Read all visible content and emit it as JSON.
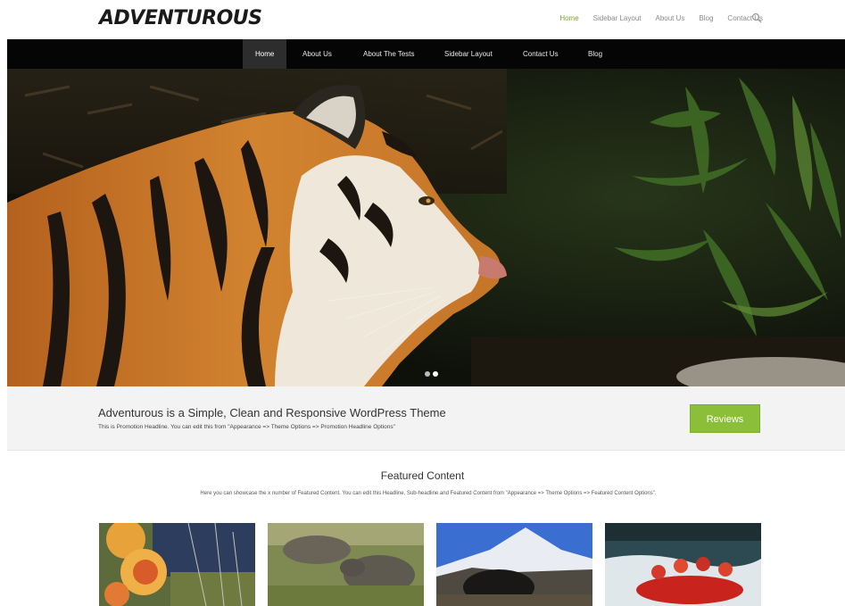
{
  "header": {
    "logo": "ADVENTUROUS",
    "top_nav": [
      "Home",
      "Sidebar Layout",
      "About Us",
      "Blog",
      "Contact Us"
    ],
    "active_top": "Home"
  },
  "main_nav": {
    "items": [
      "Home",
      "About Us",
      "About The Tests",
      "Sidebar Layout",
      "Contact Us",
      "Blog"
    ],
    "active": "Home"
  },
  "hero": {
    "image": "tiger-in-jungle",
    "slides": 2,
    "active_slide": 2
  },
  "promo": {
    "title": "Adventurous is a Simple, Clean and Responsive WordPress Theme",
    "subtitle": "This is Promotion Headline. You can edit this from \"Appearance => Theme Options => Promotion Headline Options\"",
    "button_label": "Reviews"
  },
  "featured": {
    "title": "Featured Content",
    "description": "Here you can showcase the x number of Featured Content. You can edit this Headline, Sub-headline and Featured Content from \"Appearance => Theme Options => Featured Content Options\".",
    "thumbnails": [
      "climbing-gear",
      "rhinos-grazing",
      "yak-and-mountain",
      "river-rafting"
    ]
  },
  "colors": {
    "accent_green": "#8bbf3a",
    "active_link": "#7aa12a",
    "nav_bar": "#050505"
  }
}
